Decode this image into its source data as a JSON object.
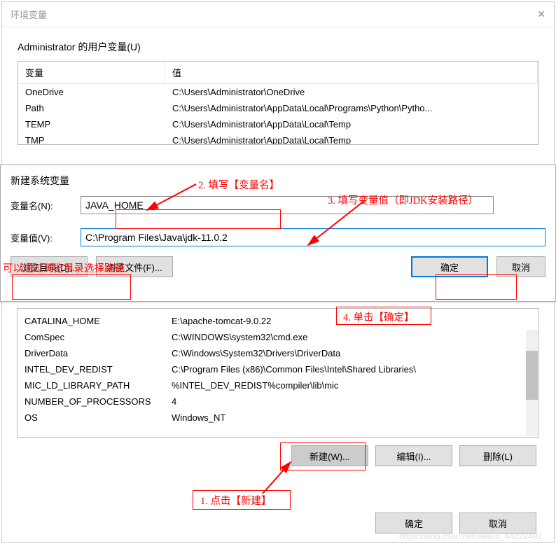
{
  "window": {
    "title": "环境变量"
  },
  "user_vars": {
    "group_label": "Administrator 的用户变量(U)",
    "header_var": "变量",
    "header_val": "值",
    "rows": [
      {
        "name": "OneDrive",
        "value": "C:\\Users\\Administrator\\OneDrive"
      },
      {
        "name": "Path",
        "value": "C:\\Users\\Administrator\\AppData\\Local\\Programs\\Python\\Pytho..."
      },
      {
        "name": "TEMP",
        "value": "C:\\Users\\Administrator\\AppData\\Local\\Temp"
      },
      {
        "name": "TMP",
        "value": "C:\\Users\\Administrator\\AppData\\Local\\Temp"
      }
    ]
  },
  "dialog": {
    "title": "新建系统变量",
    "name_label": "变量名(N):",
    "name_value": "JAVA_HOME",
    "value_label": "变量值(V):",
    "value_value": "C:\\Program Files\\Java\\jdk-11.0.2",
    "browse_dir": "浏览目录(D)...",
    "browse_file": "浏览文件(F)...",
    "ok": "确定",
    "cancel": "取消"
  },
  "sys_vars": {
    "rows": [
      {
        "name": "CATALINA_HOME",
        "value": "E:\\apache-tomcat-9.0.22"
      },
      {
        "name": "ComSpec",
        "value": "C:\\WINDOWS\\system32\\cmd.exe"
      },
      {
        "name": "DriverData",
        "value": "C:\\Windows\\System32\\Drivers\\DriverData"
      },
      {
        "name": "INTEL_DEV_REDIST",
        "value": "C:\\Program Files (x86)\\Common Files\\Intel\\Shared Libraries\\"
      },
      {
        "name": "MIC_LD_LIBRARY_PATH",
        "value": "%INTEL_DEV_REDIST%compiler\\lib\\mic"
      },
      {
        "name": "NUMBER_OF_PROCESSORS",
        "value": "4"
      },
      {
        "name": "OS",
        "value": "Windows_NT"
      }
    ],
    "btn_new": "新建(W)...",
    "btn_edit": "编辑(I)...",
    "btn_delete": "删除(L)"
  },
  "main_buttons": {
    "ok": "确定",
    "cancel": "取消"
  },
  "annotations": {
    "a1": "1. 点击【新建】",
    "a2": "2. 填写【变量名】",
    "a3": "3. 填写变量值（即JDK安装路径）",
    "a4": "4. 单击【确定】",
    "a5": "可以通过浏览目录选择路径"
  },
  "watermark": "https://blog.csdn.net/weixin_44222492"
}
